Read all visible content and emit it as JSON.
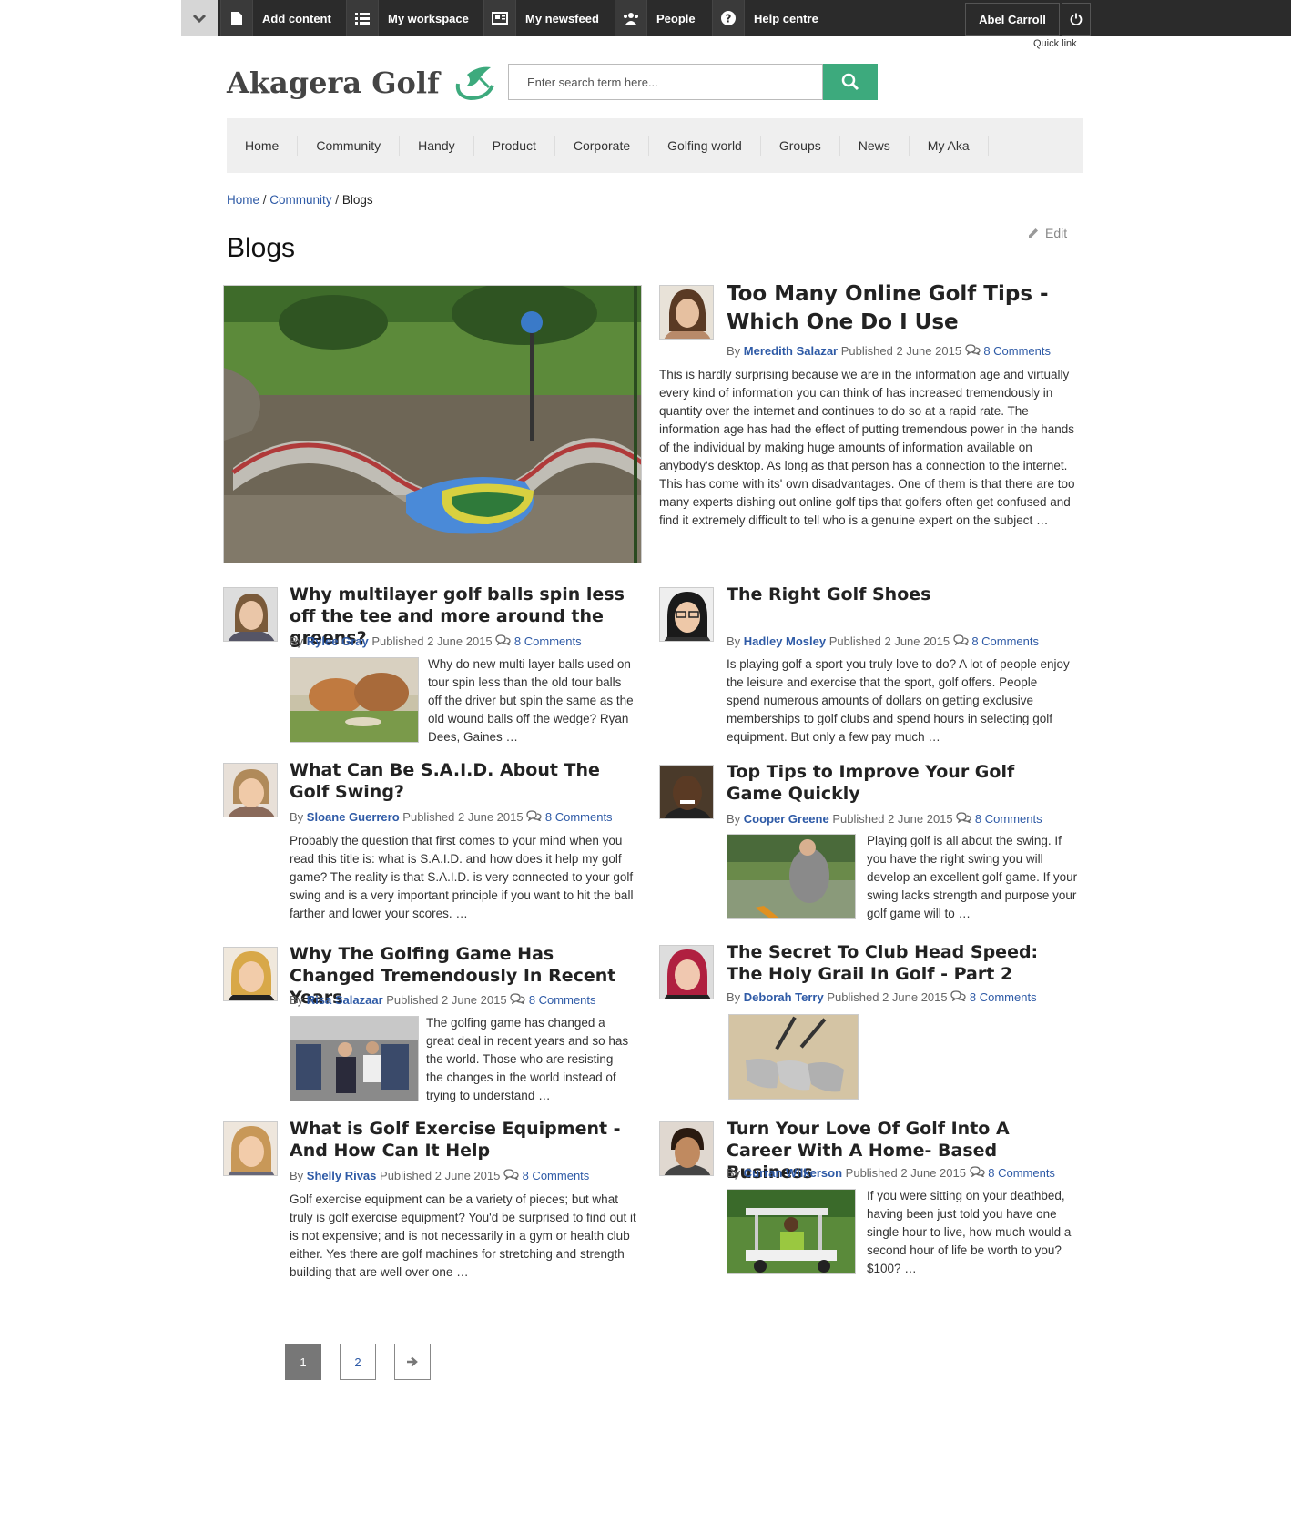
{
  "adminbar": {
    "items": [
      {
        "label": "Add content",
        "icon": "document-icon"
      },
      {
        "label": "My workspace",
        "icon": "list-icon"
      },
      {
        "label": "My newsfeed",
        "icon": "newspaper-icon"
      },
      {
        "label": "People",
        "icon": "people-icon"
      },
      {
        "label": "Help centre",
        "icon": "help-icon"
      }
    ],
    "user": "Abel Carroll",
    "quick_link": "Quick link"
  },
  "site": {
    "name": "Akagera Golf"
  },
  "search": {
    "placeholder": "Enter search term here..."
  },
  "nav": [
    "Home",
    "Community",
    "Handy",
    "Product",
    "Corporate",
    "Golfing world",
    "Groups",
    "News",
    "My Aka"
  ],
  "breadcrumb": {
    "home": "Home",
    "community": "Community",
    "current": "Blogs"
  },
  "page": {
    "title": "Blogs",
    "edit": "Edit"
  },
  "labels": {
    "by": "By",
    "published": "Published"
  },
  "posts": [
    {
      "title": "Too Many Online Golf Tips - Which One Do I Use",
      "author": "Meredith Salazar",
      "date": "2 June 2015",
      "comments": "8 Comments",
      "excerpt": "This is hardly surprising because we are in the information age and virtually every kind of information you can think of has increased tremendously in quantity over the internet and continues to do so at a rapid rate. The information age has had the effect of putting tremendous power in the hands of the individual by making huge amounts of information available on anybody's desktop. As long as that person has a connection to the internet. This has come with its' own disadvantages. One of them is that there are too many experts dishing out online golf tips that golfers often get confused and find it extremely difficult to tell who is a genuine expert on the subject …"
    },
    {
      "title": "Why multilayer golf balls spin less off the tee and more around the greens?",
      "author": "Rylee Gray",
      "date": "2 June 2015",
      "comments": "8 Comments",
      "excerpt": "Why do new multi layer balls used on tour spin less than the old tour balls off the driver but spin the same as the old wound balls off the wedge? Ryan Dees, Gaines …"
    },
    {
      "title": "The Right Golf Shoes",
      "author": "Hadley Mosley",
      "date": "2 June 2015",
      "comments": "8 Comments",
      "excerpt": "Is playing golf a sport you truly love to do? A lot of people enjoy the leisure and exercise that the sport, golf offers. People spend numerous amounts of dollars on getting exclusive memberships to golf clubs and spend hours in selecting golf equipment. But only a few pay much …"
    },
    {
      "title": "What Can Be S.A.I.D. About The Golf Swing?",
      "author": "Sloane Guerrero",
      "date": "2 June 2015",
      "comments": "8 Comments",
      "excerpt": "Probably the question that first comes to your mind when you read this title is: what is S.A.I.D. and how does it help my golf game? The reality is that S.A.I.D. is very connected to your golf swing and is a very important principle if you want to hit the ball farther and lower your scores. …"
    },
    {
      "title": "Top Tips to Improve Your Golf Game Quickly",
      "author": "Cooper Greene",
      "date": "2 June 2015",
      "comments": "8 Comments",
      "excerpt": "Playing golf is all about the swing. If you have the right swing you will develop an excellent golf game. If your swing lacks strength and purpose your golf game will to …"
    },
    {
      "title": "Why The Golfing Game Has Changed Tremendously In Recent Years",
      "author": "Risa Salazaar",
      "date": "2 June 2015",
      "comments": "8 Comments",
      "excerpt": "The golfing game has changed a great deal in recent years and so has the world. Those who are resisting the changes in the world instead of trying to understand …"
    },
    {
      "title": "The Secret To Club Head Speed: The Holy Grail In Golf - Part 2",
      "author": "Deborah Terry",
      "date": "2 June 2015",
      "comments": "8 Comments",
      "excerpt": ""
    },
    {
      "title": "What is Golf Exercise Equipment - And How Can It Help",
      "author": "Shelly Rivas",
      "date": "2 June 2015",
      "comments": "8 Comments",
      "excerpt": "Golf exercise equipment can be a variety of pieces; but what truly is golf exercise equipment? You'd be surprised to find out it is not expensive; and is not necessarily in a gym or health club either. Yes there are golf machines for stretching and strength building that are well over one …"
    },
    {
      "title": "Turn Your Love Of Golf Into A Career With A Home- Based Business",
      "author": "Curran Wilkerson",
      "date": "2 June 2015",
      "comments": "8 Comments",
      "excerpt": "If you were sitting on your deathbed, having been just told you have one single hour to live, how much would a second hour of life be worth to you? $100? …"
    }
  ],
  "pager": {
    "page1": "1",
    "page2": "2"
  },
  "colors": {
    "accent": "#3daa7d",
    "link": "#2e5aa6",
    "bar": "#2b2b2b"
  }
}
